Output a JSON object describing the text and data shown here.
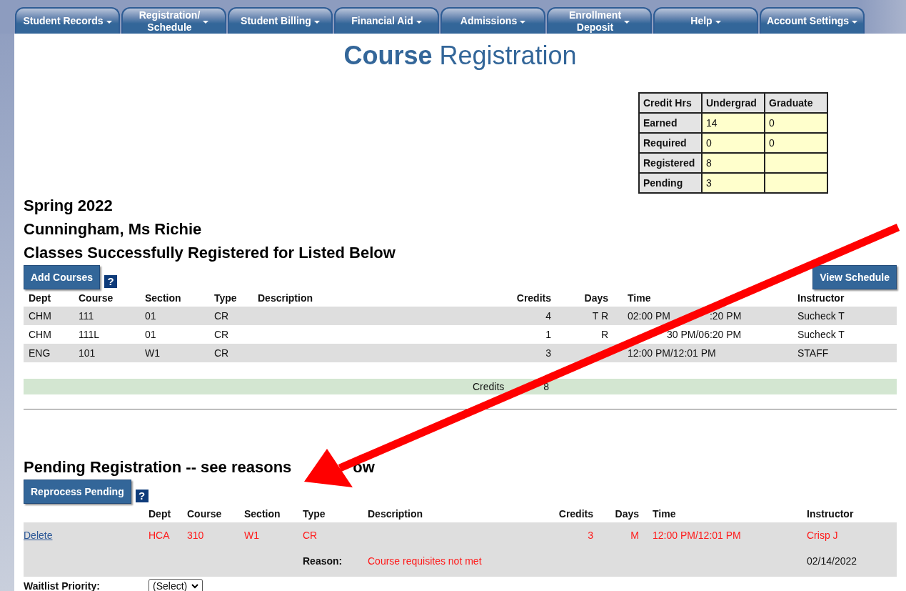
{
  "nav": [
    {
      "lines": [
        "Student Records"
      ]
    },
    {
      "lines": [
        "Registration/",
        "Schedule"
      ]
    },
    {
      "lines": [
        "Student Billing"
      ]
    },
    {
      "lines": [
        "Financial Aid"
      ]
    },
    {
      "lines": [
        "Admissions"
      ]
    },
    {
      "lines": [
        "Enrollment",
        "Deposit"
      ]
    },
    {
      "lines": [
        "Help"
      ]
    },
    {
      "lines": [
        "Account Settings"
      ]
    }
  ],
  "title": "**Course** Registration",
  "credit_table": {
    "columns": [
      "Credit Hrs",
      "Undergrad",
      "Graduate"
    ],
    "rows": [
      {
        "label": "Earned",
        "values": [
          "14",
          "0"
        ]
      },
      {
        "label": "Required",
        "values": [
          "0",
          "0"
        ]
      },
      {
        "label": "Registered",
        "values": [
          "8"
        ]
      },
      {
        "label": "Pending",
        "values": [
          "3"
        ]
      }
    ]
  },
  "term": "Spring 2022",
  "student": "Cunningham, Ms Richie",
  "registered": {
    "heading": "Classes Successfully Registered for Listed Below",
    "add_button": "Add Courses",
    "help": "?",
    "view_button": "View Schedule",
    "columns": [
      "Dept",
      "Course",
      "Section",
      "Type",
      "Description",
      "Credits",
      "Days",
      "Time",
      "Instructor"
    ],
    "rows": [
      {
        "dept": "CHM",
        "course": "111",
        "section": "01",
        "type": "CR",
        "credits": "4",
        "days": "T R",
        "time": [
          {
            "kind": "head",
            "text": "02:00 PM"
          },
          {
            "kind": "tail",
            "text": ":20 PM"
          }
        ],
        "instructor": "Sucheck T"
      },
      {
        "dept": "CHM",
        "course": "111L",
        "section": "01",
        "type": "CR",
        "credits": "1",
        "days": "R",
        "time": [
          {
            "kind": "tail",
            "text": "30 PM/06:20 PM"
          }
        ],
        "instructor": "Sucheck T"
      },
      {
        "dept": "ENG",
        "course": "101",
        "section": "W1",
        "type": "CR",
        "credits": "3",
        "time": [
          {
            "kind": "head",
            "text": "12:00 PM/12:01 PM"
          }
        ],
        "instructor": "STAFF"
      }
    ],
    "total_label": "Credits",
    "total": "8"
  },
  "pending": {
    "heading": [
      {
        "kind": "head",
        "text": "Pending Registration -- see reasons"
      },
      {
        "kind": "tail",
        "text": "ow"
      }
    ],
    "button": "Reprocess Pending",
    "help": "?",
    "columns": [
      "Dept",
      "Course",
      "Section",
      "Type",
      "Description",
      "Credits",
      "Days",
      "Time",
      "Instructor"
    ],
    "rows": [
      {
        "action": "Delete",
        "dept": "HCA",
        "course": "310",
        "section": "W1",
        "type": "CR",
        "credits": "3",
        "days": "M",
        "time": "12:00 PM/12:01 PM",
        "instructor": "Crisp J",
        "reason_label": "Reason:",
        "reason": "Course requisites not met",
        "date": "02/14/2022",
        "waitlist_label": "Waitlist Priority:",
        "waitlist_value": "(Select)"
      }
    ]
  }
}
